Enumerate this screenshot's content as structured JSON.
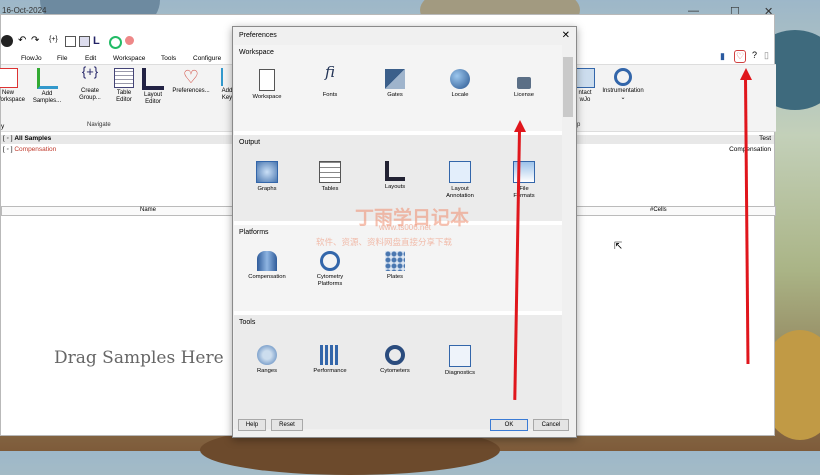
{
  "window": {
    "title": "16-Oct-2024",
    "minimize": "—",
    "maximize": "☐",
    "close": "✕"
  },
  "menu": {
    "items": [
      "FlowJo",
      "File",
      "Edit",
      "Workspace",
      "Tools",
      "Configure"
    ]
  },
  "ribbon": {
    "buttons": [
      {
        "label": "New\nWorkspace",
        "icon": "new-workspace-icon"
      },
      {
        "label": "Add\nSamples...",
        "icon": "add-samples-icon"
      },
      {
        "label": "Create\nGroup...",
        "icon": "create-group-icon"
      },
      {
        "label": "Table\nEditor",
        "icon": "table-editor-icon"
      },
      {
        "label": "Layout\nEditor",
        "icon": "layout-editor-icon"
      },
      {
        "label": "Preferences...",
        "icon": "preferences-heart-icon"
      },
      {
        "label": "Add\nKey",
        "icon": "add-key-icon"
      }
    ],
    "navigate_label": "Navigate",
    "right": [
      {
        "label": "ntact\nwJo",
        "icon": "contact-icon"
      },
      {
        "label": "Instrumentation",
        "icon": "instrumentation-icon"
      }
    ],
    "right_group_label": "p"
  },
  "tree": {
    "all_samples": "All Samples",
    "compensation": "Compensation",
    "right_header": "Test",
    "right_value": "Compensation"
  },
  "columns": {
    "name": "Name",
    "cells": "#Cells"
  },
  "drag_text": "Drag Samples Here",
  "dialog": {
    "title": "Preferences",
    "close": "✕",
    "sections": [
      {
        "title": "Workspace",
        "items": [
          "Workspace",
          "Fonts",
          "Gates",
          "Locale",
          "License"
        ]
      },
      {
        "title": "Output",
        "items": [
          "Graphs",
          "Tables",
          "Layouts",
          "Layout\nAnnotation",
          "File\nFormats"
        ]
      },
      {
        "title": "Platforms",
        "items": [
          "Compensation",
          "Cytometry\nPlatforms",
          "Plates"
        ]
      },
      {
        "title": "Tools",
        "items": [
          "Ranges",
          "Performance",
          "Cytometers",
          "Diagnostics"
        ]
      }
    ],
    "buttons": {
      "help": "Help",
      "reset": "Reset",
      "ok": "OK",
      "cancel": "Cancel"
    }
  },
  "watermark": {
    "line1": "丁雨学日记本",
    "line2": "www.ts006.net",
    "line3": "软件、资源、资料网盘直接分享下载"
  },
  "colors": {
    "accent": "#3a7bd5",
    "compensation": "#c0392b",
    "arrow": "#e0161c"
  }
}
